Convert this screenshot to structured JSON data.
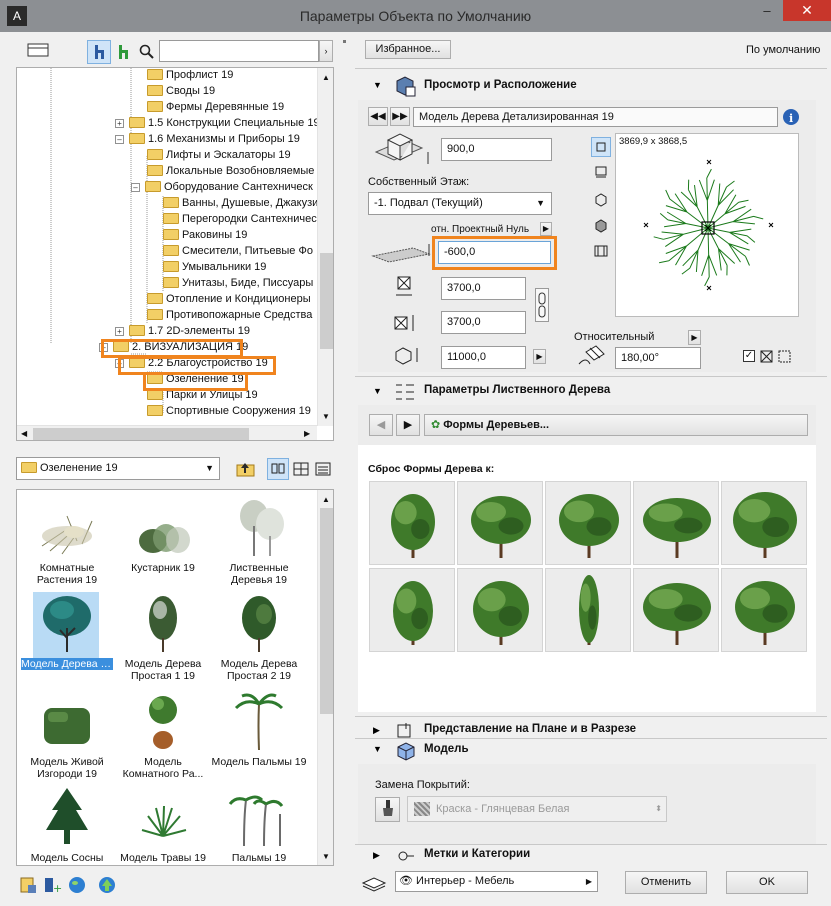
{
  "window": {
    "title": "Параметры Объекта по Умолчанию",
    "minimize": "–",
    "close": "✕"
  },
  "left": {
    "search_placeholder": "",
    "tree": [
      {
        "label": "Профлист 19",
        "expander": ""
      },
      {
        "label": "Своды 19",
        "expander": ""
      },
      {
        "label": "Фермы Деревянные 19",
        "expander": ""
      },
      {
        "label": "1.5 Конструкции Специальные 19",
        "expander": "+"
      },
      {
        "label": "1.6 Механизмы и Приборы 19",
        "expander": "–"
      },
      {
        "label": "Лифты и Эскалаторы 19",
        "expander": ""
      },
      {
        "label": "Локальные Возобновляемые",
        "expander": ""
      },
      {
        "label": "Оборудование Сантехническ",
        "expander": "–"
      },
      {
        "label": "Ванны, Душевые, Джакузи",
        "expander": ""
      },
      {
        "label": "Перегородки Сантехничес",
        "expander": ""
      },
      {
        "label": "Раковины 19",
        "expander": ""
      },
      {
        "label": "Смесители, Питьевые Фо",
        "expander": ""
      },
      {
        "label": "Умывальники 19",
        "expander": ""
      },
      {
        "label": "Унитазы, Биде, Писсуары",
        "expander": ""
      },
      {
        "label": "Отопление и Кондиционеры",
        "expander": ""
      },
      {
        "label": "Противопожарные Средства",
        "expander": ""
      },
      {
        "label": "1.7 2D-элементы 19",
        "expander": "+"
      },
      {
        "label": "2. ВИЗУАЛИЗАЦИЯ 19",
        "expander": "–"
      },
      {
        "label": "2.2 Благоустройство 19",
        "expander": "–"
      },
      {
        "label": "Озеленение 19",
        "expander": ""
      },
      {
        "label": "Парки и Улицы 19",
        "expander": ""
      },
      {
        "label": "Спортивные Сооружения 19",
        "expander": ""
      }
    ],
    "folder_select": "Озеленение 19",
    "gallery": [
      {
        "label": "Комнатные Растения 19"
      },
      {
        "label": "Кустарник 19"
      },
      {
        "label": "Лиственные Деревья 19"
      },
      {
        "label": "Модель Дерева Детализированная"
      },
      {
        "label": "Модель Дерева Простая 1 19"
      },
      {
        "label": "Модель Дерева Простая 2 19"
      },
      {
        "label": "Модель Живой Изгороди 19"
      },
      {
        "label": "Модель Комнатного Ра..."
      },
      {
        "label": "Модель Пальмы 19"
      },
      {
        "label": "Модель Сосны"
      },
      {
        "label": "Модель Травы 19"
      },
      {
        "label": "Пальмы 19"
      }
    ]
  },
  "right": {
    "favorites": "Избранное...",
    "default_label": "По умолчанию",
    "sections": {
      "preview": "Просмотр и Расположение",
      "tree_params": "Параметры Лиственного Дерева",
      "plan": "Представление на Плане и в Разрезе",
      "model": "Модель",
      "labels": "Метки и Категории"
    },
    "object_name": "Модель Дерева Детализированная 19",
    "height": "900,0",
    "story_label": "Собственный Этаж:",
    "story_value": "-1. Подвал (Текущий)",
    "elev_ref": "отн. Проектный Нуль",
    "elevation": "-600,0",
    "size_x": "3700,0",
    "size_y": "3700,0",
    "size_z": "11000,0",
    "preview_dims": "3869,9 x 3868,5",
    "relative_label": "Относительный",
    "angle": "180,00°",
    "tree_forms_button": "Формы Деревьев...",
    "reset_label": "Сброс Формы Дерева к:",
    "surface_label": "Замена Покрытий:",
    "surface_value": "Краска - Глянцевая Белая",
    "layer_value": "Интерьер - Мебель",
    "cancel": "Отменить",
    "ok": "OK"
  }
}
